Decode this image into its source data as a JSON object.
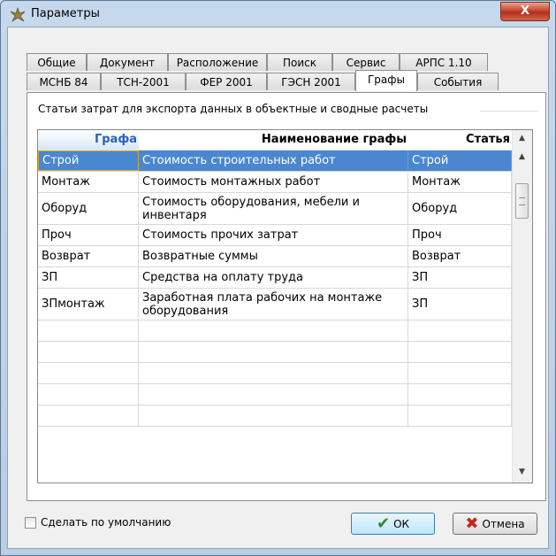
{
  "window": {
    "title": "Параметры",
    "close_label": "X"
  },
  "tabs_row1": [
    "Общие",
    "Документ",
    "Расположение",
    "Поиск",
    "Сервис",
    "АРПС 1.10"
  ],
  "tabs_row2": [
    "МСНБ 84",
    "ТСН-2001",
    "ФЕР 2001",
    "ГЭСН 2001",
    "Графы",
    "События"
  ],
  "active_tab": "Графы",
  "group": {
    "title": "Статьи затрат для экспорта данных в объектные и сводные расчеты"
  },
  "grid": {
    "headers": [
      "Графа",
      "Наименование графы",
      "Статья"
    ],
    "rows": [
      [
        "Строй",
        "Стоимость строительных работ",
        "Строй"
      ],
      [
        "Монтаж",
        "Стоимость монтажных работ",
        "Монтаж"
      ],
      [
        "Оборуд",
        "Стоимость оборудования, мебели и инвентаря",
        "Оборуд"
      ],
      [
        "Проч",
        "Стоимость прочих затрат",
        "Проч"
      ],
      [
        "Возврат",
        "Возвратные суммы",
        "Возврат"
      ],
      [
        "ЗП",
        "Средства на оплату труда",
        "ЗП"
      ],
      [
        "ЗПмонтаж",
        "Заработная плата рабочих на монтаже оборудования",
        "ЗП"
      ],
      [
        "",
        "",
        ""
      ],
      [
        "",
        "",
        ""
      ],
      [
        "",
        "",
        ""
      ],
      [
        "",
        "",
        ""
      ],
      [
        "",
        "",
        ""
      ]
    ],
    "selected_row": 0
  },
  "footer": {
    "default_label": "Сделать по умолчанию",
    "ok_label": "ОК",
    "cancel_label": "Отмена"
  }
}
